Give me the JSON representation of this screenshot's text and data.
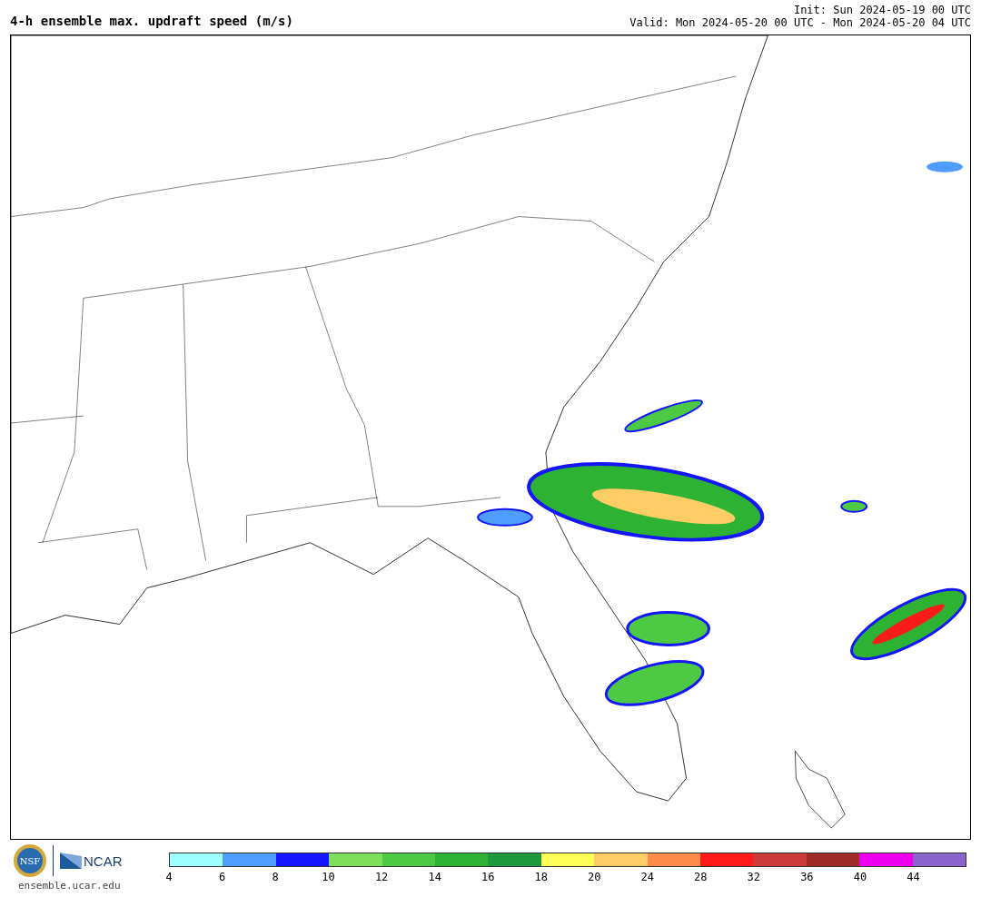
{
  "title": "4-h ensemble max. updraft speed (m/s)",
  "init": "Init: Sun 2024-05-19 00 UTC",
  "valid": "Valid: Mon 2024-05-20 00 UTC - Mon 2024-05-20 04 UTC",
  "logos": {
    "nsf": "NSF",
    "ncar": "NCAR",
    "site": "ensemble.ucar.edu"
  },
  "colorbar": {
    "bins": [
      {
        "color": "#a0ffff",
        "tick": "4"
      },
      {
        "color": "#4f9dff",
        "tick": "6"
      },
      {
        "color": "#1414ff",
        "tick": "8"
      },
      {
        "color": "#7ee05a",
        "tick": "10"
      },
      {
        "color": "#4ec944",
        "tick": "12"
      },
      {
        "color": "#2db233",
        "tick": "14"
      },
      {
        "color": "#1e9a3c",
        "tick": "16"
      },
      {
        "color": "#ffff55",
        "tick": "18"
      },
      {
        "color": "#ffcc66",
        "tick": "20"
      },
      {
        "color": "#ff8c4a",
        "tick": "24"
      },
      {
        "color": "#ff1a1a",
        "tick": "28"
      },
      {
        "color": "#cc3a3a",
        "tick": "32"
      },
      {
        "color": "#a02a2a",
        "tick": "36"
      },
      {
        "color": "#ee00ee",
        "tick": "40"
      },
      {
        "color": "#8a64cc",
        "tick": "44"
      }
    ]
  }
}
